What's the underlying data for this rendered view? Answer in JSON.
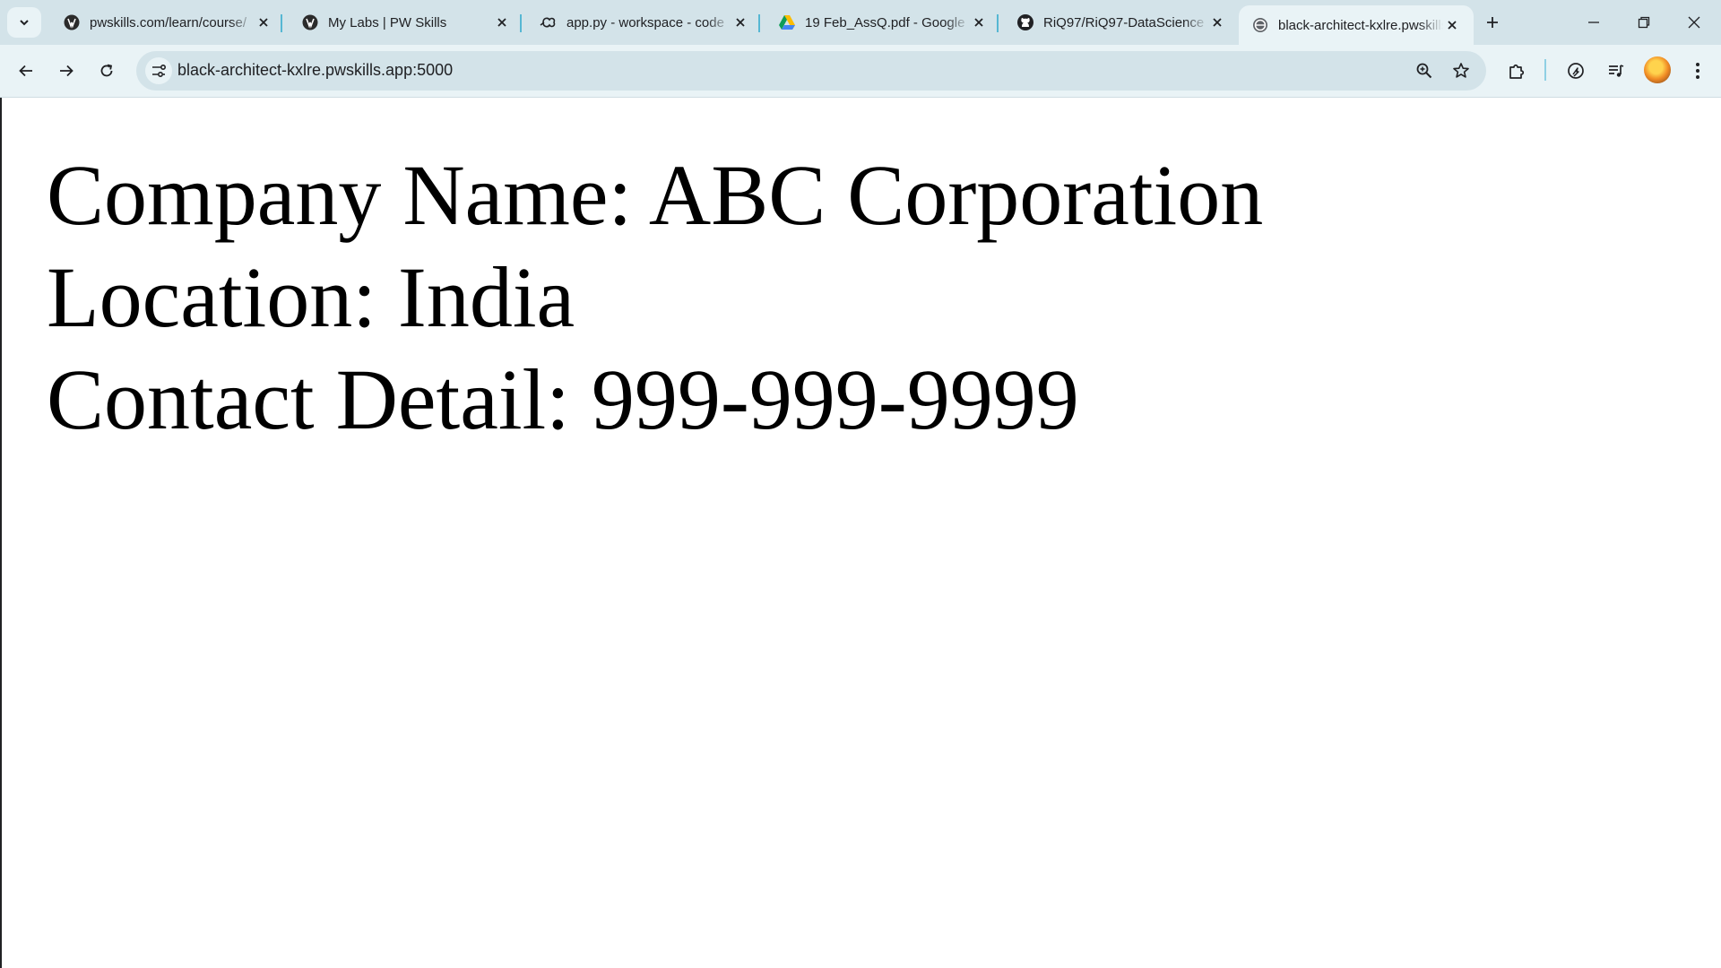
{
  "browser": {
    "tabs": [
      {
        "title": "pwskills.com/learn/course/",
        "favicon": "pwskills-icon",
        "active": false
      },
      {
        "title": "My Labs | PW Skills",
        "favicon": "pwskills-icon",
        "active": false
      },
      {
        "title": "app.py - workspace - code",
        "favicon": "code-server-icon",
        "active": false
      },
      {
        "title": "19 Feb_AssQ.pdf - Google",
        "favicon": "google-drive-icon",
        "active": false
      },
      {
        "title": "RiQ97/RiQ97-DataScience",
        "favicon": "github-icon",
        "active": false
      },
      {
        "title": "black-architect-kxlre.pwskills",
        "favicon": "globe-icon",
        "active": true
      }
    ],
    "address": "black-architect-kxlre.pwskills.app:5000",
    "icons": {
      "tab_search": "chevron-down-icon",
      "new_tab": "plus-icon",
      "minimize": "minimize-icon",
      "restore": "restore-icon",
      "close_window": "close-icon",
      "back": "back-arrow-icon",
      "forward": "forward-arrow-icon",
      "reload": "reload-icon",
      "site_info": "site-settings-icon",
      "zoom": "zoom-icon",
      "bookmark": "star-icon",
      "extensions": "puzzle-icon",
      "performance": "speedometer-icon",
      "media": "media-playlist-icon",
      "menu": "kebab-menu-icon"
    },
    "colors": {
      "tabstrip": "#d3e3e9",
      "toolbar": "#e9f3f6",
      "tab_separator": "#56b7d3"
    }
  },
  "page": {
    "company_line": "Company Name: ABC Corporation",
    "location_line": "Location: India",
    "contact_line": "Contact Detail: 999-999-9999"
  }
}
